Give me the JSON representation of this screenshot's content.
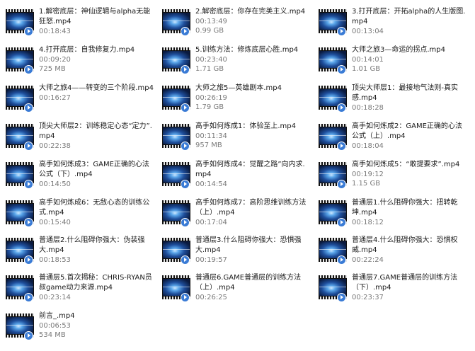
{
  "files": [
    {
      "name": "1.解密底层：神仙逻辑与alpha无能狂怒.mp4",
      "duration": "00:18:43"
    },
    {
      "name": "2.解密底层：你存在完美主义.mp4",
      "duration": "00:13:49",
      "size": "0.99 GB"
    },
    {
      "name": "3.打开底层：开拓alpha的人生版图.mp4",
      "duration": "00:13:04"
    },
    {
      "name": "4.打开底层：自我修复力.mp4",
      "duration": "00:09:20",
      "size": "725 MB"
    },
    {
      "name": "5.训练方法：修炼底层心胜.mp4",
      "duration": "00:23:40",
      "size": "1.71 GB"
    },
    {
      "name": "大师之旅3—命运的拐点.mp4",
      "duration": "00:14:01",
      "size": "1.01 GB"
    },
    {
      "name": "大师之旅4——转变的三个阶段.mp4",
      "duration": "00:16:27"
    },
    {
      "name": "大师之旅5—英雄剧本.mp4",
      "duration": "00:26:19",
      "size": "1.79 GB"
    },
    {
      "name": "顶尖大师层1：最接地气法则-真实感.mp4",
      "duration": "00:18:28"
    },
    {
      "name": "顶尖大师层2：训练稳定心态“定力”.mp4",
      "duration": "00:22:38"
    },
    {
      "name": "高手如何炼成1：体验至上.mp4",
      "duration": "00:11:34",
      "size": "957 MB"
    },
    {
      "name": "高手如何炼成2：GAME正确的心法公式（上）.mp4",
      "duration": "00:18:04"
    },
    {
      "name": "高手如何炼成3：GAME正确的心法公式（下）.mp4",
      "duration": "00:14:50"
    },
    {
      "name": "高手如何炼成4：觉醒之路”向内求.mp4",
      "duration": "00:14:54"
    },
    {
      "name": "高手如何炼成5：“敢提要求”.mp4",
      "duration": "00:19:12",
      "size": "1.15 GB"
    },
    {
      "name": "高手如何炼成6：无敌心态的训练公式.mp4",
      "duration": "00:15:40"
    },
    {
      "name": "高手如何炼成7：高阶思维训练方法（上）.mp4",
      "duration": "00:17:04"
    },
    {
      "name": "普通层1.什么阻碍你强大：扭转乾坤.mp4",
      "duration": "00:18:12"
    },
    {
      "name": "普通层2.什么阻碍你强大：伪装强大.mp4",
      "duration": "00:18:53"
    },
    {
      "name": "普通层3.什么阻碍你强大：恐惧强大.mp4",
      "duration": "00:19:57"
    },
    {
      "name": "普通层4.什么阻碍你强大：恐惧权威.mp4",
      "duration": "00:22:24"
    },
    {
      "name": "普通层5.首次揭秘：CHRIS-RYAN员叔game动力来源.mp4",
      "duration": "00:23:14"
    },
    {
      "name": "普通层6.GAME普通层的训练方法（上）.mp4",
      "duration": "00:26:25"
    },
    {
      "name": "普通层7.GAME普通层的训练方法（下）.mp4",
      "duration": "00:23:37"
    },
    {
      "name": "前言_.mp4",
      "duration": "00:06:53",
      "size": "534 MB"
    }
  ]
}
